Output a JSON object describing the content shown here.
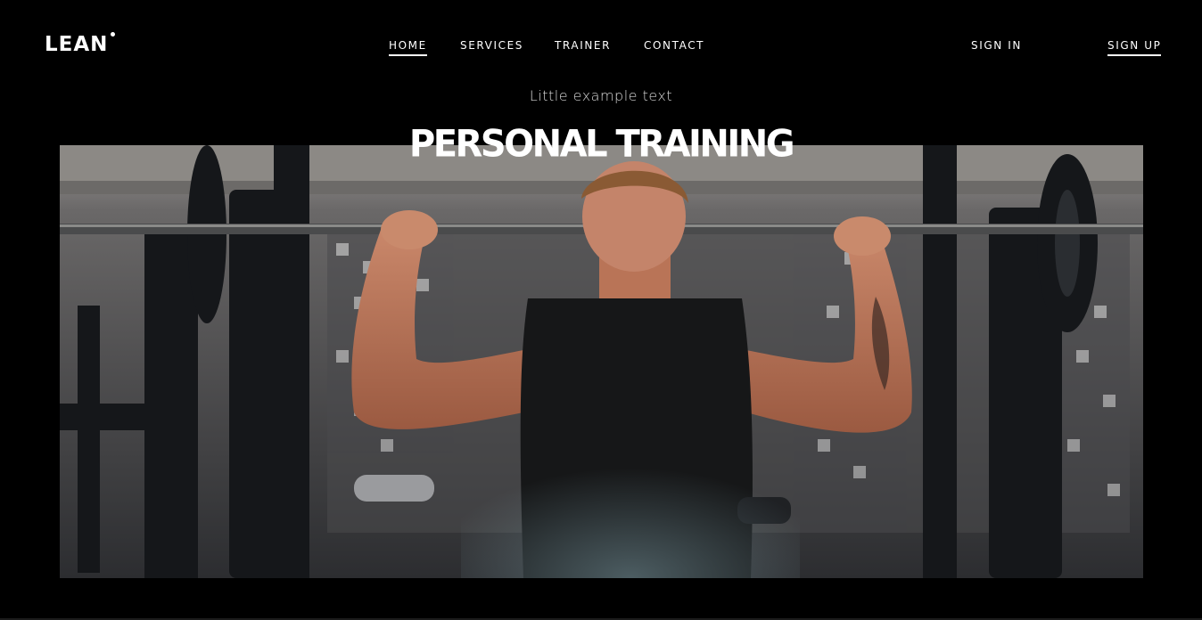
{
  "brand": {
    "name": "LEAN"
  },
  "nav": {
    "items": [
      {
        "label": "HOME",
        "active": true
      },
      {
        "label": "SERVICES",
        "active": false
      },
      {
        "label": "TRAINER",
        "active": false
      },
      {
        "label": "CONTACT",
        "active": false
      }
    ],
    "sign_in": "SIGN IN",
    "sign_up": "SIGN UP"
  },
  "hero": {
    "subtitle": "Little example text",
    "title": "PERSONAL TRAINING",
    "image_subject": "man-lifting-barbell-in-gym"
  },
  "colors": {
    "background": "#000000",
    "text": "#ffffff",
    "subtitle": "#d6d6d6"
  }
}
